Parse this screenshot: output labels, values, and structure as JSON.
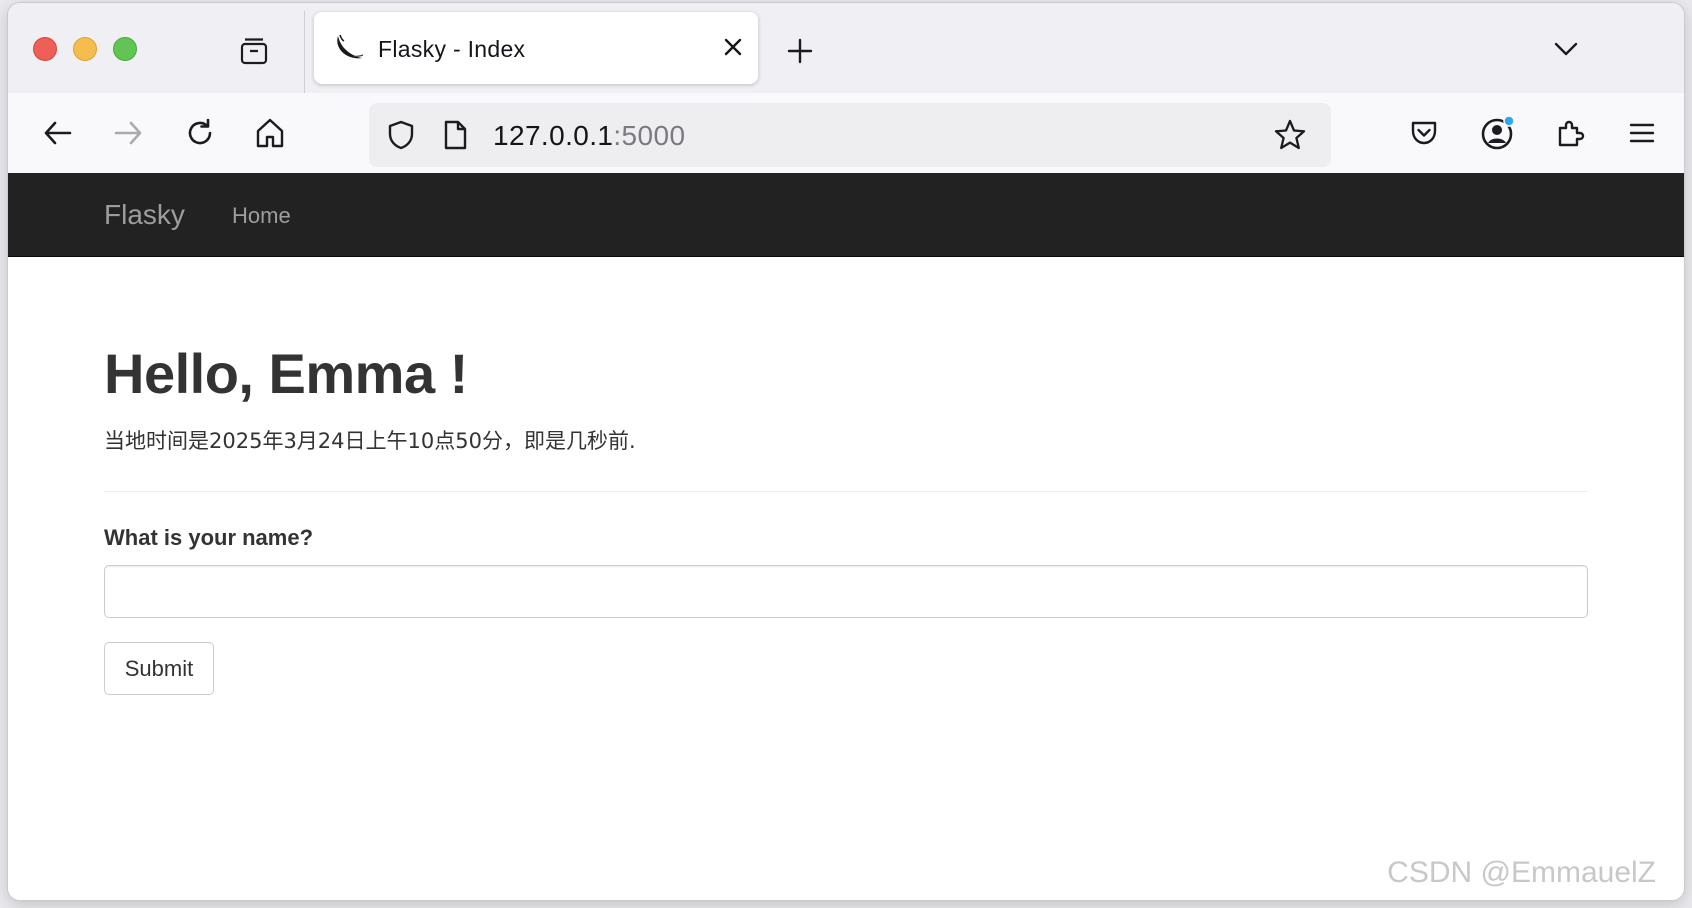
{
  "browser": {
    "tab": {
      "title": "Flasky - Index"
    },
    "urlbar": {
      "host": "127.0.0.1",
      "port": ":5000"
    },
    "icons": [
      "tab-groups-icon",
      "flask-favicon-icon",
      "close-icon",
      "plus-icon",
      "chevron-down-icon",
      "back-arrow-icon",
      "forward-arrow-icon",
      "reload-icon",
      "home-icon",
      "shield-icon",
      "page-icon",
      "star-icon",
      "pocket-icon",
      "account-icon",
      "extensions-icon",
      "hamburger-menu-icon"
    ]
  },
  "site": {
    "brand": "Flasky",
    "nav": {
      "home": "Home"
    },
    "greeting": "Hello, Emma !",
    "local_time": "当地时间是2025年3月24日上午10点50分，即是几秒前.",
    "form": {
      "label": "What is your name?",
      "name_value": "",
      "submit": "Submit"
    }
  },
  "watermark": "CSDN @EmmauelZ",
  "colors": {
    "navbar_bg": "#222222",
    "navbar_text": "#9d9d9d",
    "text": "#333333",
    "account_badge": "#2fa7e8"
  }
}
